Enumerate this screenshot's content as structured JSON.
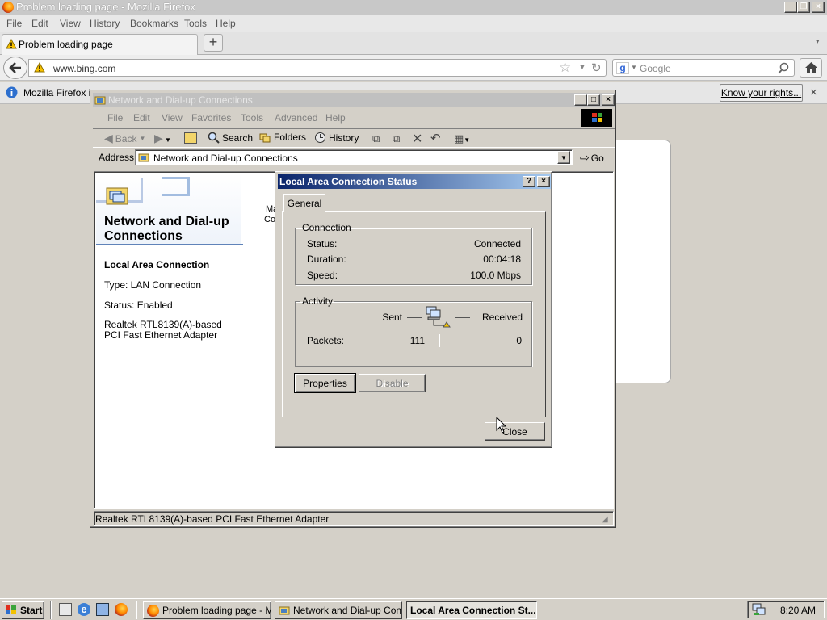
{
  "firefox": {
    "window_title": "Problem loading page - Mozilla Firefox",
    "menu": [
      "File",
      "Edit",
      "View",
      "History",
      "Bookmarks",
      "Tools",
      "Help"
    ],
    "tab_title": "Problem loading page",
    "new_tab": "+",
    "url": "www.bing.com",
    "search_placeholder": "Google",
    "notification_text": "Mozilla Firefox is",
    "know_rights_button": "Know your rights...",
    "notification_close": "×"
  },
  "explorer": {
    "title": "Network and Dial-up Connections",
    "menu": [
      "File",
      "Edit",
      "View",
      "Favorites",
      "Tools",
      "Advanced",
      "Help"
    ],
    "toolbar": {
      "back": "Back",
      "search": "Search",
      "folders": "Folders",
      "history": "History"
    },
    "address_label": "Address",
    "address_value": "Network and Dial-up Connections",
    "go_label": "Go",
    "panel_heading": "Network and Dial-up Connections",
    "selected_name": "Local Area Connection",
    "type_line": "Type: LAN Connection",
    "status_line": "Status: Enabled",
    "adapter_line": "Realtek RTL8139(A)-based PCI Fast Ethernet Adapter",
    "icon_fragment_1": "Ma",
    "icon_fragment_2": "Co",
    "status_bar": "Realtek RTL8139(A)-based PCI Fast Ethernet Adapter"
  },
  "dialog": {
    "title": "Local Area Connection Status",
    "help_btn": "?",
    "close_x": "×",
    "tab_general": "General",
    "connection_group": "Connection",
    "status_label": "Status:",
    "status_value": "Connected",
    "duration_label": "Duration:",
    "duration_value": "00:04:18",
    "speed_label": "Speed:",
    "speed_value": "100.0 Mbps",
    "activity_group": "Activity",
    "sent_label": "Sent",
    "received_label": "Received",
    "packets_label": "Packets:",
    "packets_sent": "111",
    "packets_received": "0",
    "properties_button": "Properties",
    "disable_button": "Disable",
    "close_button": "Close"
  },
  "taskbar": {
    "start": "Start",
    "tasks": [
      "Problem loading page - M...",
      "Network and Dial-up Con...",
      "Local Area Connection St..."
    ],
    "clock": "8:20 AM"
  }
}
